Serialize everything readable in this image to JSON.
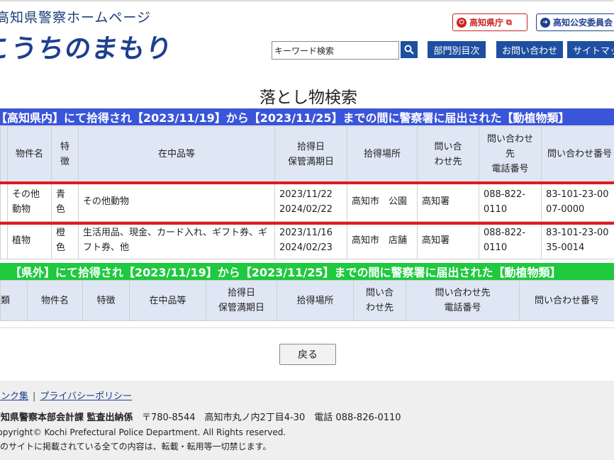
{
  "header": {
    "site_title": "高知県警察ホームページ",
    "logo_text": "こうちのまもり",
    "pref_button": "高知県庁",
    "kouan_button": "高知公安委員会",
    "search_value": "キーワード検索",
    "search_icon": "magnifier-icon",
    "nav": [
      "部門別目次",
      "お問い合わせ",
      "サイトマップ"
    ]
  },
  "page_title": "落とし物検索",
  "section1": {
    "banner": "【高知県内】にて拾得され【2023/11/19】から【2023/11/25】までの間に警察署に届出された【動植物類】",
    "headers": [
      "物件名",
      "特徴",
      "在中品等",
      "拾得日\n保管満期日",
      "拾得場所",
      "問い合わせ先",
      "問い合わせ先電話番号",
      "問い合わせ番号"
    ],
    "rows": [
      {
        "name": "その他動物",
        "feature": "青色",
        "contents": "その他動物",
        "found_date": "2023/11/22",
        "expiry_date": "2024/02/22",
        "place": "高知市　公園",
        "contact": "高知署",
        "phone": "088-822-0110",
        "number": "83-101-23-0007-0000"
      },
      {
        "name": "植物",
        "feature": "橙色",
        "contents": "生活用品、現金、カード入れ、ギフト券、ギフト券、他",
        "found_date": "2023/11/16",
        "expiry_date": "2024/02/23",
        "place": "高知市　店舗",
        "contact": "高知署",
        "phone": "088-822-0110",
        "number": "83-101-23-0035-0014"
      }
    ]
  },
  "section2": {
    "banner": "【県外】にて拾得され【2023/11/19】から【2023/11/25】までの間に警察署に届出された【動植物類】",
    "headers": [
      "種類",
      "物件名",
      "特徴",
      "在中品等",
      "拾得日\n保管満期日",
      "拾得場所",
      "問い合わせ先",
      "問い合わせ先\n電話番号",
      "問い合わせ番号"
    ]
  },
  "back_button": "戻る",
  "footer": {
    "link1": "リンク集",
    "link2": "プライバシーポリシー",
    "org_bold": "高知県警察本部会計課 監査出納係",
    "org_address": "〒780-8544　高知市丸ノ内2丁目4-30　電話 088-826-0110",
    "copyright": "Copyright© Kochi Prefectural Police Department. All Rights reserved.",
    "note": "このサイトに掲載されている全ての内容は、転載・転用等一切禁じます。"
  }
}
